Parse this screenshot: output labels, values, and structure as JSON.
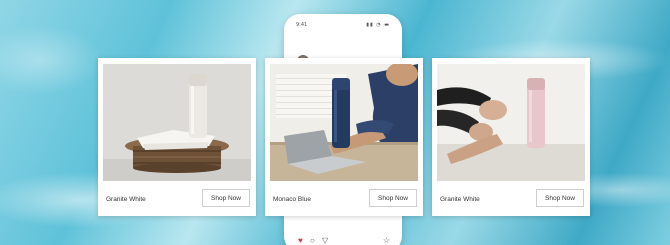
{
  "phone": {
    "status_time": "9:41",
    "status_icons": "▮▮ ◔ ▬",
    "more_label": "•••",
    "actions": {
      "like": "♥",
      "comment": "○",
      "share": "▽",
      "save": "☆"
    }
  },
  "products": [
    {
      "name": "Granite White",
      "button": "Shop Now",
      "bottle_color": "#e9e6df",
      "cap_color": "#d9d5cd"
    },
    {
      "name": "Monaco Blue",
      "button": "Shop Now",
      "bottle_color": "#243a5e",
      "cap_color": "#2d4670"
    },
    {
      "name": "Granite White",
      "button": "Shop Now",
      "bottle_color": "#e9c6c9",
      "cap_color": "#d8b1b5"
    }
  ],
  "colors": {
    "accent_like": "#e0334b",
    "background_water": "#5fc2d9"
  }
}
